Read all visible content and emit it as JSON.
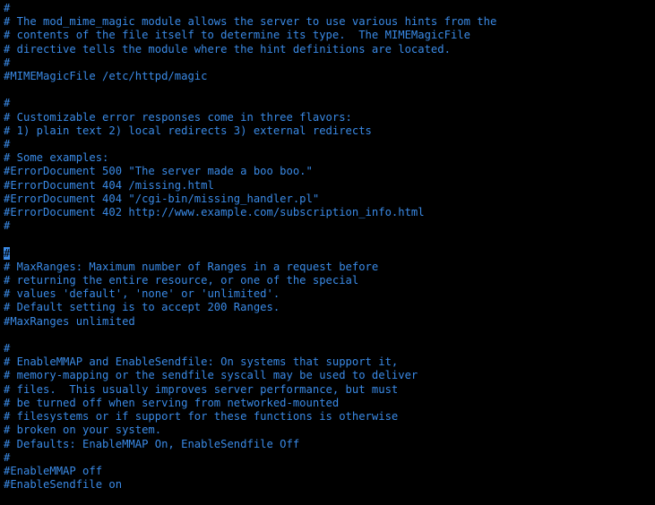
{
  "lines": [
    "#",
    "# The mod_mime_magic module allows the server to use various hints from the",
    "# contents of the file itself to determine its type.  The MIMEMagicFile",
    "# directive tells the module where the hint definitions are located.",
    "#",
    "#MIMEMagicFile /etc/httpd/magic",
    "",
    "#",
    "# Customizable error responses come in three flavors:",
    "# 1) plain text 2) local redirects 3) external redirects",
    "#",
    "# Some examples:",
    "#ErrorDocument 500 \"The server made a boo boo.\"",
    "#ErrorDocument 404 /missing.html",
    "#ErrorDocument 404 \"/cgi-bin/missing_handler.pl\"",
    "#ErrorDocument 402 http://www.example.com/subscription_info.html",
    "#",
    "",
    "#",
    "# MaxRanges: Maximum number of Ranges in a request before",
    "# returning the entire resource, or one of the special",
    "# values 'default', 'none' or 'unlimited'.",
    "# Default setting is to accept 200 Ranges.",
    "#MaxRanges unlimited",
    "",
    "#",
    "# EnableMMAP and EnableSendfile: On systems that support it,",
    "# memory-mapping or the sendfile syscall may be used to deliver",
    "# files.  This usually improves server performance, but must",
    "# be turned off when serving from networked-mounted",
    "# filesystems or if support for these functions is otherwise",
    "# broken on your system.",
    "# Defaults: EnableMMAP On, EnableSendfile Off",
    "#",
    "#EnableMMAP off",
    "#EnableSendfile on"
  ],
  "cursor": {
    "line": 18,
    "col": 0
  }
}
